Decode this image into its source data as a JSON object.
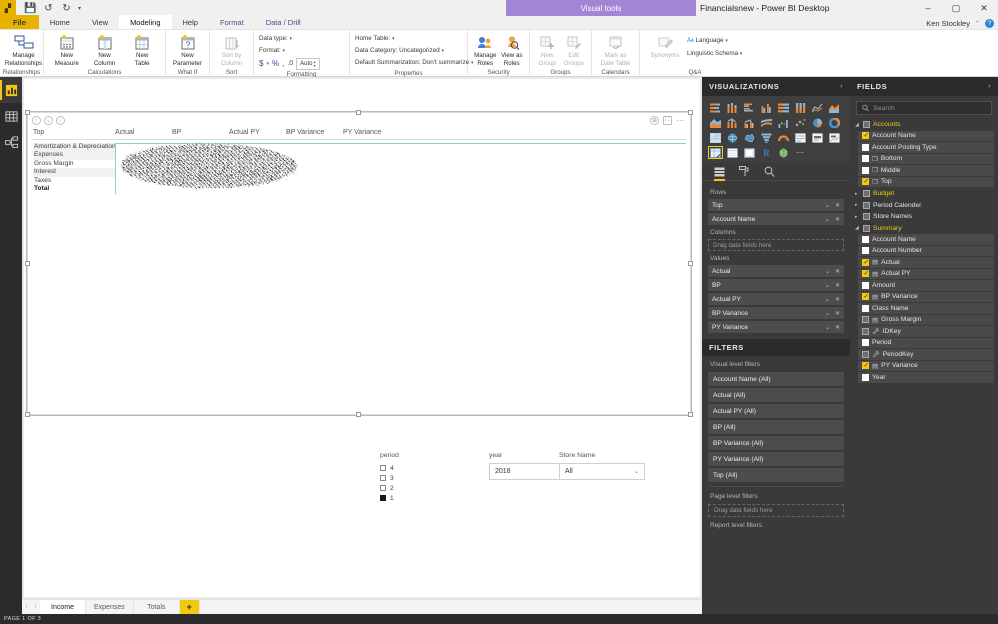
{
  "titlebar": {
    "app_icon": "powerbi-icon",
    "quick_access": [
      "save-icon",
      "undo-icon",
      "redo-icon",
      "customize-caret"
    ],
    "contextual_tab_badge": "Visual tools",
    "document_title": "Financialsnew - Power BI Desktop",
    "window_buttons": [
      "minimize",
      "restore",
      "close"
    ]
  },
  "ribbon": {
    "tabs": [
      {
        "label": "File",
        "kind": "file"
      },
      {
        "label": "Home",
        "kind": "normal"
      },
      {
        "label": "View",
        "kind": "normal"
      },
      {
        "label": "Modeling",
        "kind": "active"
      },
      {
        "label": "Help",
        "kind": "normal"
      },
      {
        "label": "Format",
        "kind": "contextual"
      },
      {
        "label": "Data / Drill",
        "kind": "contextual"
      }
    ],
    "user_name": "Ken Stockley",
    "groups": [
      {
        "name": "Relationships",
        "buttons": [
          {
            "label": "Manage\nRelationships",
            "icon": "relationships-icon"
          }
        ]
      },
      {
        "name": "Calculations",
        "buttons": [
          {
            "label": "New\nMeasure",
            "icon": "new-measure-icon"
          },
          {
            "label": "New\nColumn",
            "icon": "new-column-icon"
          },
          {
            "label": "New\nTable",
            "icon": "new-table-icon"
          }
        ]
      },
      {
        "name": "What If",
        "buttons": [
          {
            "label": "New\nParameter",
            "icon": "new-parameter-icon"
          }
        ]
      },
      {
        "name": "Sort",
        "buttons": [
          {
            "label": "Sort by\nColumn",
            "icon": "sort-by-column-icon",
            "disabled": true
          }
        ]
      },
      {
        "name": "Formatting",
        "rows": [
          "Data type:",
          "Format:"
        ],
        "format_buttons": [
          "$",
          "%",
          ",",
          "decimal"
        ],
        "auto_label": "Auto"
      },
      {
        "name": "Properties",
        "rows": [
          "Home Table:",
          "Data Category: Uncategorized",
          "Default Summarization: Don't summarize"
        ]
      },
      {
        "name": "Security",
        "buttons": [
          {
            "label": "Manage\nRoles",
            "icon": "manage-roles-icon"
          },
          {
            "label": "View as\nRoles",
            "icon": "view-as-roles-icon"
          }
        ]
      },
      {
        "name": "Groups",
        "buttons": [
          {
            "label": "New\nGroup",
            "icon": "new-group-icon",
            "disabled": true
          },
          {
            "label": "Edit\nGroups",
            "icon": "edit-groups-icon",
            "disabled": true
          }
        ]
      },
      {
        "name": "Calendars",
        "buttons": [
          {
            "label": "Mark as\nDate Table",
            "icon": "mark-as-date-table-icon",
            "disabled": true
          }
        ]
      },
      {
        "name": "Q&A",
        "buttons": [
          {
            "label": "Synonyms",
            "icon": "synonyms-icon",
            "disabled": true
          }
        ],
        "rows": [
          "Language",
          "Linguistic Schema"
        ]
      }
    ]
  },
  "view_rail": [
    {
      "name": "report-view",
      "icon": "chart-icon",
      "active": true
    },
    {
      "name": "data-view",
      "icon": "table-icon",
      "active": false
    },
    {
      "name": "model-view",
      "icon": "model-icon",
      "active": false
    }
  ],
  "visual": {
    "header_left_icons": [
      "drill-up-icon",
      "expand-all-icon",
      "drill-down-icon"
    ],
    "header_right_icons": [
      "filter-info-icon",
      "focus-mode-icon",
      "more-options-icon"
    ],
    "row_header": "Top",
    "column_headers": [
      "Actual",
      "BP",
      "Actual PY",
      "BP Variance",
      "PY Variance"
    ],
    "rows": [
      {
        "label": "Amortization & Depreciation",
        "total": false
      },
      {
        "label": "Expenses",
        "total": false
      },
      {
        "label": "Gross Margin",
        "total": false
      },
      {
        "label": "Interest",
        "total": false
      },
      {
        "label": "Taxes",
        "total": false
      },
      {
        "label": "Total",
        "total": true
      }
    ],
    "data_region_note": "redacted"
  },
  "slicers": {
    "period": {
      "title": "period",
      "items": [
        {
          "label": "4",
          "checked": false
        },
        {
          "label": "3",
          "checked": false
        },
        {
          "label": "2",
          "checked": false
        },
        {
          "label": "1",
          "checked": true
        }
      ]
    },
    "year": {
      "title": "year",
      "value": "2018"
    },
    "store_name": {
      "title": "Store Name",
      "value": "All"
    }
  },
  "page_tabs": {
    "tabs": [
      {
        "label": "Income",
        "active": true
      },
      {
        "label": "Expenses",
        "active": false
      },
      {
        "label": "Totals",
        "active": false
      }
    ],
    "add_label": "+",
    "status": "PAGE 1 OF 3"
  },
  "visualizations": {
    "title": "VISUALIZATIONS",
    "collapse_icon": "chevron-right-icon",
    "gallery": [
      "stacked-bar-chart",
      "stacked-column-chart",
      "clustered-bar-chart",
      "clustered-column-chart",
      "100-stacked-bar-chart",
      "100-stacked-column-chart",
      "line-chart",
      "area-chart",
      "stacked-area-chart",
      "line-stacked-column-chart",
      "line-clustered-column-chart",
      "ribbon-chart",
      "waterfall-chart",
      "scatter-chart",
      "pie-chart",
      "donut-chart",
      "treemap",
      "map",
      "filled-map",
      "funnel",
      "gauge",
      "multi-row-card",
      "card",
      "kpi",
      "slicer",
      "table",
      "matrix",
      "r-script-visual",
      "globe-custom-visual",
      "more-visuals"
    ],
    "selected_visual": "matrix",
    "well_tabs": [
      "fields-tab",
      "format-tab",
      "analytics-tab"
    ],
    "active_well_tab": "fields-tab",
    "wells": [
      {
        "label": "Rows",
        "chips": [
          "Top",
          "Account Name"
        ]
      },
      {
        "label": "Columns",
        "placeholder": "Drag data fields here",
        "chips": []
      },
      {
        "label": "Values",
        "chips": [
          "Actual",
          "BP",
          "Actual PY",
          "BP Variance",
          "PY Variance"
        ]
      }
    ]
  },
  "filters": {
    "title": "FILTERS",
    "visual_level_label": "Visual level filters",
    "visual_level_filters": [
      "Account Name (All)",
      "Actual  (All)",
      "Actual PY  (All)",
      "BP (All)",
      "BP Variance (All)",
      "PY Variance (All)",
      "Top  (All)"
    ],
    "page_level_label": "Page level filters",
    "page_level_placeholder": "Drag data fields here",
    "report_level_label": "Report level filters"
  },
  "fields": {
    "title": "FIELDS",
    "collapse_icon": "chevron-right-icon",
    "search_placeholder": "Search",
    "search_icon": "search-icon",
    "tree": [
      {
        "name": "Accounts",
        "type": "table",
        "expanded": true,
        "checked": false,
        "children": [
          {
            "name": "Account Name",
            "checked": true,
            "icon": "none"
          },
          {
            "name": "Account Posting Type",
            "checked": false,
            "icon": "none"
          },
          {
            "name": "Bottom",
            "checked": false,
            "icon": "hierarchy"
          },
          {
            "name": "Middle",
            "checked": false,
            "icon": "hierarchy"
          },
          {
            "name": "Top",
            "checked": true,
            "icon": "hierarchy"
          }
        ]
      },
      {
        "name": "Budget",
        "type": "table",
        "expanded": false,
        "checked": false,
        "children": []
      },
      {
        "name": "Period Calender",
        "type": "table-plain",
        "expanded": false,
        "checked": false,
        "children": []
      },
      {
        "name": "Store Names",
        "type": "table-plain",
        "expanded": false,
        "checked": false,
        "children": []
      },
      {
        "name": "Summary",
        "type": "table",
        "expanded": true,
        "checked": false,
        "children": [
          {
            "name": "Account Name",
            "checked": false,
            "icon": "none"
          },
          {
            "name": "Account Number",
            "checked": false,
            "icon": "none"
          },
          {
            "name": "Actual",
            "checked": true,
            "icon": "sigma"
          },
          {
            "name": "Actual PY",
            "checked": true,
            "icon": "sigma"
          },
          {
            "name": "Amount",
            "checked": false,
            "icon": "none"
          },
          {
            "name": "BP Variance",
            "checked": true,
            "icon": "sigma"
          },
          {
            "name": "Class Name",
            "checked": false,
            "icon": "none"
          },
          {
            "name": "Gross Margin",
            "checked": false,
            "icon": "sigma"
          },
          {
            "name": "IDKey",
            "checked": false,
            "icon": "key"
          },
          {
            "name": "Period",
            "checked": false,
            "icon": "none"
          },
          {
            "name": "PeriodKey",
            "checked": false,
            "icon": "key"
          },
          {
            "name": "PY Variance",
            "checked": true,
            "icon": "sigma"
          },
          {
            "name": "Year",
            "checked": false,
            "icon": "none"
          }
        ]
      }
    ]
  },
  "colors": {
    "accent_yellow": "#f2c811",
    "pane_dark": "#3a3a3a",
    "pane_header": "#2b2b2b",
    "contextual_purple": "#a385d6",
    "matrix_border_teal": "#7fd4d4"
  }
}
